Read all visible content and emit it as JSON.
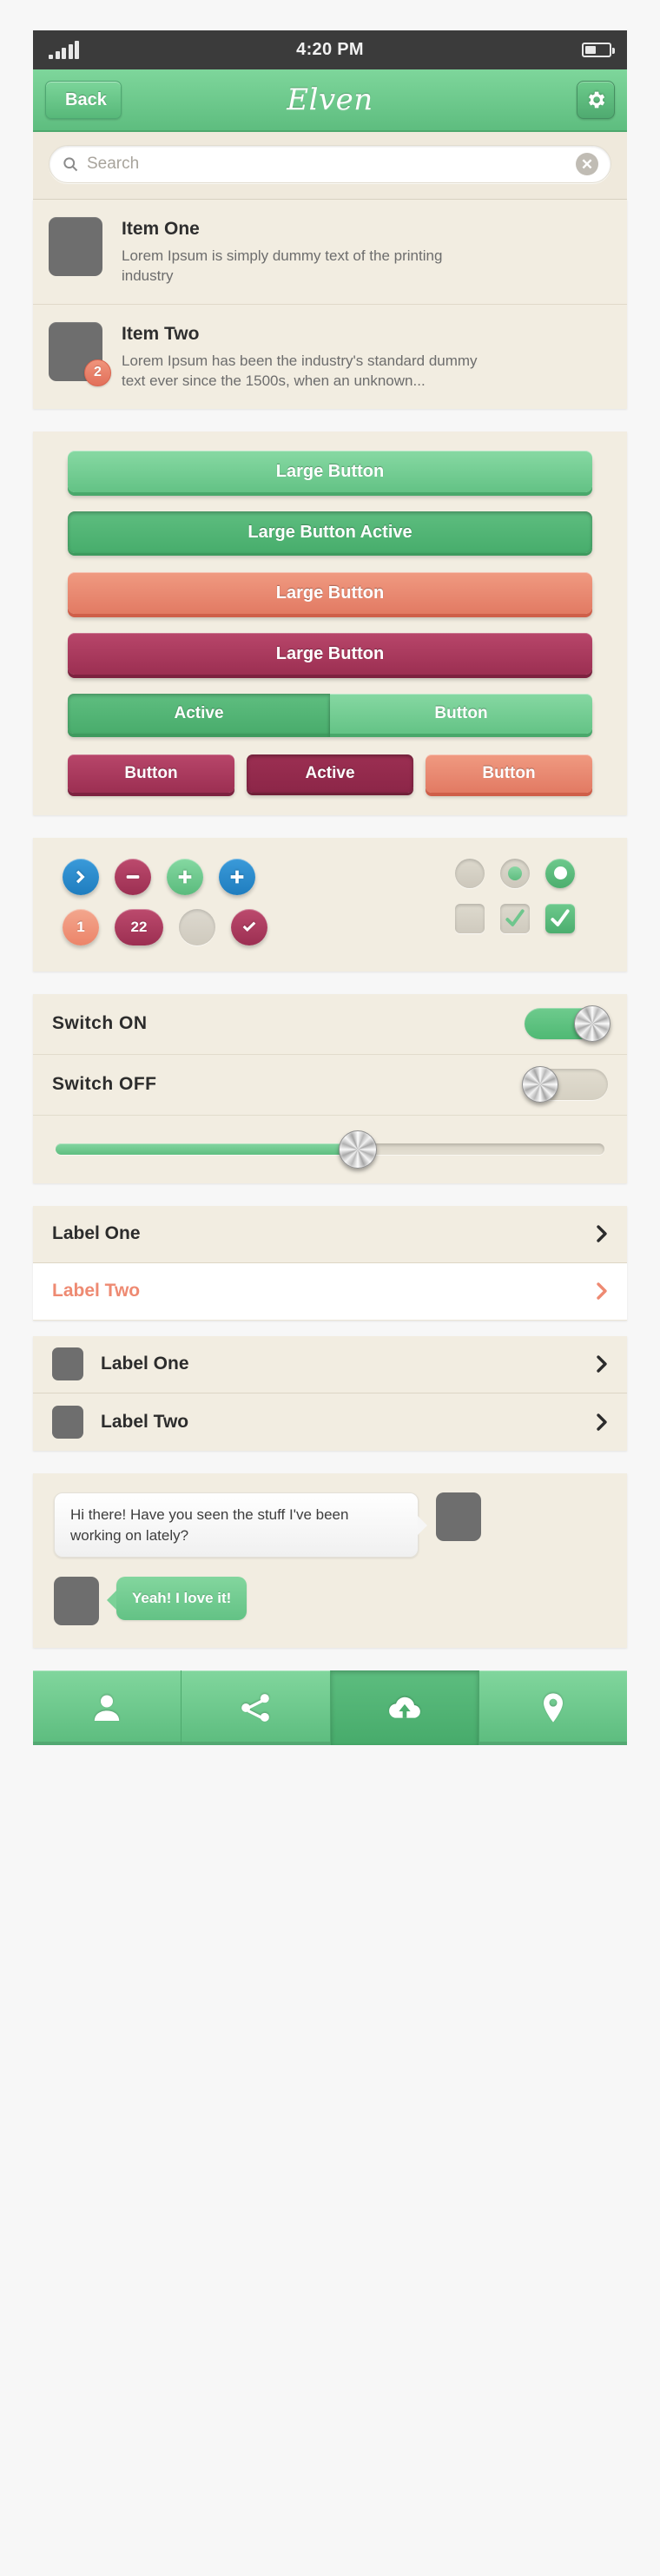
{
  "status_bar": {
    "time": "4:20 PM",
    "signal_icon": "signal-bars-icon",
    "battery_icon": "battery-icon"
  },
  "nav_bar": {
    "back_label": "Back",
    "title": "Elven",
    "settings_icon": "gear-icon"
  },
  "search": {
    "placeholder": "Search",
    "search_icon": "search-icon",
    "clear_icon": "clear-x-icon",
    "clear_glyph": "✕"
  },
  "list_items": [
    {
      "title": "Item One",
      "description": "Lorem Ipsum is simply dummy text of the printing industry",
      "badge": null
    },
    {
      "title": "Item Two",
      "description": "Lorem Ipsum has been the industry's standard dummy text ever since the 1500s, when an unknown...",
      "badge": "2"
    }
  ],
  "buttons": {
    "large": [
      {
        "label": "Large Button",
        "style": "green",
        "state": "normal"
      },
      {
        "label": "Large Button Active",
        "style": "green",
        "state": "active"
      },
      {
        "label": "Large Button",
        "style": "salmon",
        "state": "normal"
      },
      {
        "label": "Large Button",
        "style": "maroon",
        "state": "normal"
      }
    ],
    "segmented": [
      {
        "label": "Active",
        "state": "active"
      },
      {
        "label": "Button",
        "state": "normal"
      }
    ],
    "small": [
      {
        "label": "Button",
        "style": "maroon",
        "state": "normal"
      },
      {
        "label": "Active",
        "style": "maroon",
        "state": "active"
      },
      {
        "label": "Button",
        "style": "salmon",
        "state": "normal"
      }
    ]
  },
  "icons": {
    "row_one": [
      {
        "name": "chevron-right-circle",
        "color": "blue",
        "glyph": ""
      },
      {
        "name": "minus-circle",
        "color": "maroon",
        "glyph": ""
      },
      {
        "name": "plus-circle",
        "color": "green",
        "glyph": ""
      },
      {
        "name": "plus-circle",
        "color": "blue",
        "glyph": ""
      }
    ],
    "row_two": [
      {
        "name": "badge-count",
        "color": "salmon",
        "glyph": "1"
      },
      {
        "name": "badge-count",
        "color": "maroon",
        "glyph": "22"
      },
      {
        "name": "empty-circle",
        "color": "gray",
        "glyph": ""
      },
      {
        "name": "check-circle",
        "color": "maroon",
        "glyph": ""
      }
    ],
    "radios": [
      "off",
      "partial",
      "on"
    ],
    "checkboxes": [
      "off",
      "partial",
      "checked"
    ]
  },
  "switches": [
    {
      "label": "Switch  ON",
      "state": "on"
    },
    {
      "label": "Switch  OFF",
      "state": "off"
    }
  ],
  "slider": {
    "value": 55
  },
  "label_list_plain": [
    {
      "label": "Label One",
      "accent": false
    },
    {
      "label": "Label Two",
      "accent": true
    }
  ],
  "label_list_icons": [
    {
      "label": "Label One"
    },
    {
      "label": "Label Two"
    }
  ],
  "chat": [
    {
      "text": "Hi there! Have you seen the stuff I've been working on lately?",
      "direction": "incoming"
    },
    {
      "text": "Yeah! I love it!",
      "direction": "outgoing"
    }
  ],
  "tabbar": [
    {
      "icon": "person-icon",
      "active": false
    },
    {
      "icon": "share-icon",
      "active": false
    },
    {
      "icon": "cloud-upload-icon",
      "active": true
    },
    {
      "icon": "location-pin-icon",
      "active": false
    }
  ],
  "colors": {
    "green": "#63c285",
    "green_dark": "#47ab6b",
    "salmon": "#ee8a72",
    "maroon": "#9c2f52",
    "blue": "#2f8fd0",
    "cream": "#f2ede1",
    "statusbar": "#3b3b3b"
  }
}
